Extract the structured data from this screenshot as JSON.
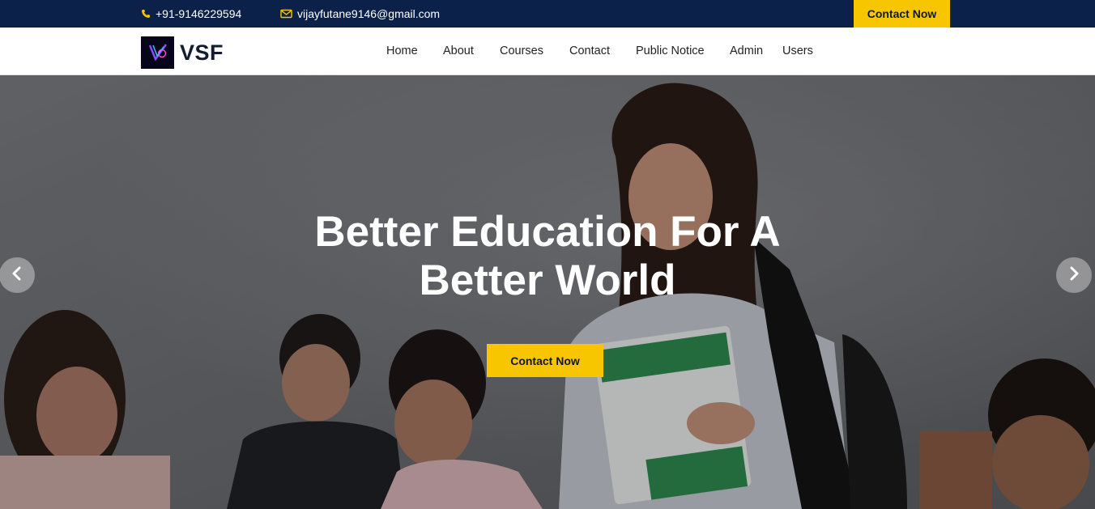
{
  "topbar": {
    "phone": "+91-9146229594",
    "email": "vijayfutane9146@gmail.com",
    "phone_icon": "phone-icon",
    "email_icon": "envelope-icon",
    "cta_label": "Contact Now"
  },
  "brand": {
    "name": "VSF",
    "logo_icon": "vsf-logo-icon"
  },
  "nav": {
    "items": [
      {
        "label": "Home"
      },
      {
        "label": "About"
      },
      {
        "label": "Courses"
      },
      {
        "label": "Contact"
      },
      {
        "label": "Public Notice"
      },
      {
        "label": "Admin"
      },
      {
        "label": "Users"
      }
    ]
  },
  "hero": {
    "title_line1": "Better Education For A",
    "title_line2": "Better World",
    "cta_label": "Contact Now",
    "prev_icon": "chevron-left-icon",
    "next_icon": "chevron-right-icon"
  },
  "colors": {
    "topbar_bg": "#0b2149",
    "accent": "#f7c600",
    "brand_text": "#141d2e"
  }
}
